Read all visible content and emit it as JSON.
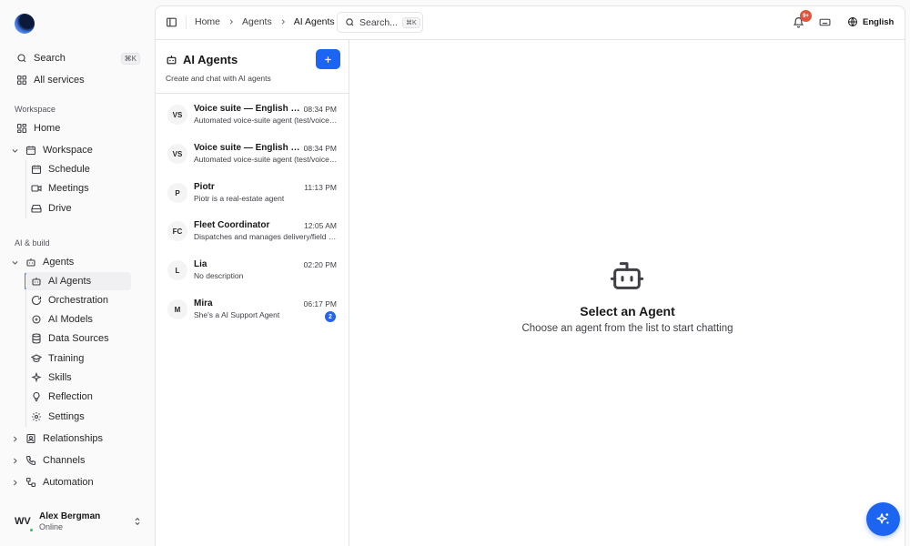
{
  "sidebar": {
    "search_label": "Search",
    "search_shortcut": "⌘K",
    "all_services": "All services",
    "section_workspace": "Workspace",
    "home": "Home",
    "workspace": {
      "label": "Workspace",
      "children": [
        "Schedule",
        "Meetings",
        "Drive"
      ]
    },
    "section_ai": "AI & build",
    "agents": {
      "label": "Agents",
      "children": [
        "AI Agents",
        "Orchestration",
        "AI Models",
        "Data Sources",
        "Training",
        "Skills",
        "Reflection",
        "Settings"
      ],
      "active": "AI Agents"
    },
    "relationships": "Relationships",
    "channels": "Channels",
    "automation": "Automation",
    "user": {
      "initials": "WV",
      "name": "Alex Bergman",
      "status": "Online"
    }
  },
  "topbar": {
    "breadcrumb": [
      "Home",
      "Agents",
      "AI Agents"
    ],
    "search_placeholder": "Search...",
    "search_shortcut": "⌘K",
    "notifications_badge": "9+",
    "language": "English"
  },
  "agent_list": {
    "title": "AI Agents",
    "subtitle": "Create and chat with AI agents",
    "agents": [
      {
        "initials": "VS",
        "name": "Voice suite — English + Spanish",
        "description": "Automated voice-suite agent (test/voice-suite)",
        "time": "08:34 PM",
        "unread": ""
      },
      {
        "initials": "VS",
        "name": "Voice suite — English only",
        "description": "Automated voice-suite agent (test/voice-suite)",
        "time": "08:34 PM",
        "unread": ""
      },
      {
        "initials": "P",
        "name": "Piotr",
        "description": "Piotr is a real-estate agent",
        "time": "11:13 PM",
        "unread": ""
      },
      {
        "initials": "FC",
        "name": "Fleet Coordinator",
        "description": "Dispatches and manages delivery/field operations",
        "time": "12:05 AM",
        "unread": ""
      },
      {
        "initials": "L",
        "name": "Lia",
        "description": "No description",
        "time": "02:20 PM",
        "unread": ""
      },
      {
        "initials": "M",
        "name": "Mira",
        "description": "She's a AI Support Agent",
        "time": "06:17 PM",
        "unread": "2"
      }
    ]
  },
  "empty_state": {
    "title": "Select an Agent",
    "subtitle": "Choose an agent from the list to start chatting"
  },
  "colors": {
    "accent": "#1c64f2",
    "badge": "#e0553d",
    "online": "#22c55e"
  }
}
